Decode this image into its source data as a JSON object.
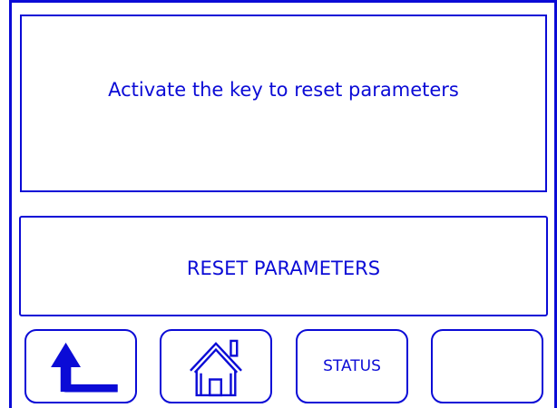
{
  "screen": {
    "message": "Activate the key to reset parameters",
    "reset_button_label": "RESET PARAMETERS"
  },
  "soft_keys": {
    "back_icon": "back-arrow-icon",
    "home_icon": "home-icon",
    "status_label": "STATUS",
    "blank_label": ""
  },
  "colors": {
    "foreground": "#0b0bd6",
    "background": "#ffffff"
  }
}
